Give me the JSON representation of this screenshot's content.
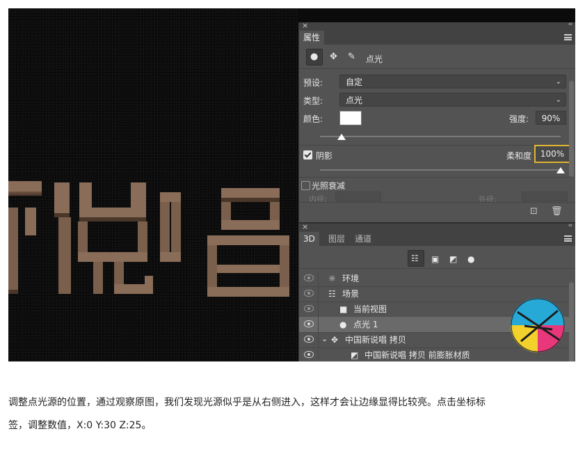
{
  "properties_panel": {
    "close_glyph": "×",
    "collapse_glyph": "‹‹",
    "tab_label": "属性",
    "mode_label": "点光",
    "preset_label": "预设:",
    "preset_value": "自定",
    "type_label": "类型:",
    "type_value": "点光",
    "color_label": "颜色:",
    "color_value": "#ffffff",
    "intensity_label": "强度:",
    "intensity_value": "90%",
    "intensity_level": 0.09,
    "shadow_label": "阴影",
    "shadow_checked": true,
    "softness_label": "柔和度",
    "softness_value": "100%",
    "softness_level": 1.0,
    "falloff_label": "光照衰减",
    "falloff_checked": false,
    "inner_label": "内径:",
    "outer_label": "外径:"
  },
  "layers_panel": {
    "close_glyph": "×",
    "collapse_glyph": "‹‹",
    "tabs": [
      "3D",
      "图层",
      "通道"
    ],
    "active_tab": "3D",
    "rows": [
      {
        "label": "环境",
        "icon": "environment-icon"
      },
      {
        "label": "场景",
        "icon": "scene-icon"
      },
      {
        "label": "当前视图",
        "icon": "camera-icon"
      },
      {
        "label": "点光 1",
        "icon": "bulb-icon",
        "selected": true
      },
      {
        "label": "中国新说唱 拷贝",
        "icon": "mesh-icon"
      },
      {
        "label": "中国新说唱 拷贝 前膨胀材质",
        "icon": "material-icon"
      }
    ]
  },
  "artwork": {
    "text": "新说唱"
  },
  "caption": {
    "line1": "调整点光源的位置，通过观察原图，我们发现光源似乎是从右侧进入，这样才会让边缘显得比较亮。点击坐标标",
    "line2": "签，调整数值，X:0 Y:30 Z:25。"
  },
  "colors": {
    "panel": "#535353",
    "highlight": "#e0b531",
    "letter_face": "#8a6d58"
  }
}
